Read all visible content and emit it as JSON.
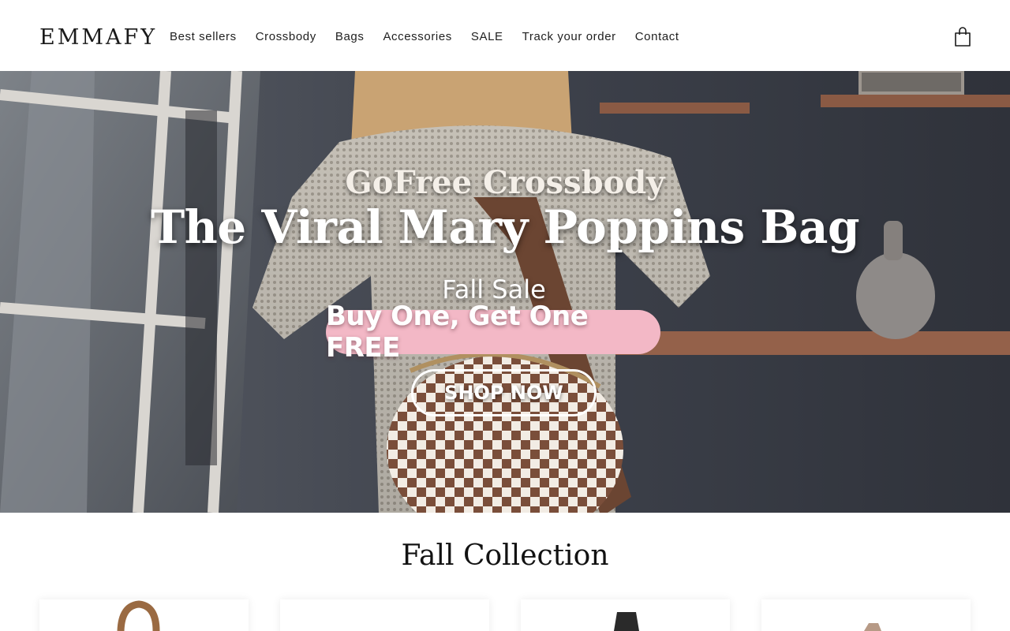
{
  "brand": {
    "logo": "EMMAFY"
  },
  "nav": {
    "items": [
      {
        "label": "Best sellers"
      },
      {
        "label": "Crossbody"
      },
      {
        "label": "Bags"
      },
      {
        "label": "Accessories"
      },
      {
        "label": "SALE"
      },
      {
        "label": "Track your order"
      },
      {
        "label": "Contact"
      }
    ],
    "cart_icon": "shopping-bag-icon"
  },
  "hero": {
    "eyebrow": "GoFree Crossbody",
    "headline": "The Viral Mary Poppins Bag",
    "sale_label": "Fall Sale",
    "promo": "Buy One, Get One FREE",
    "cta": "SHOP NOW",
    "colors": {
      "promo_pill": "#f3b8c6",
      "wall": "#3a3c44",
      "sweater": "#e6e0d6",
      "check_brown": "#7a4e3a"
    }
  },
  "collection": {
    "title": "Fall Collection",
    "products": [
      {
        "thumb": "brown-bag"
      },
      {
        "thumb": "blank"
      },
      {
        "thumb": "black-bag"
      },
      {
        "thumb": "patterned-strap-bag"
      }
    ]
  }
}
